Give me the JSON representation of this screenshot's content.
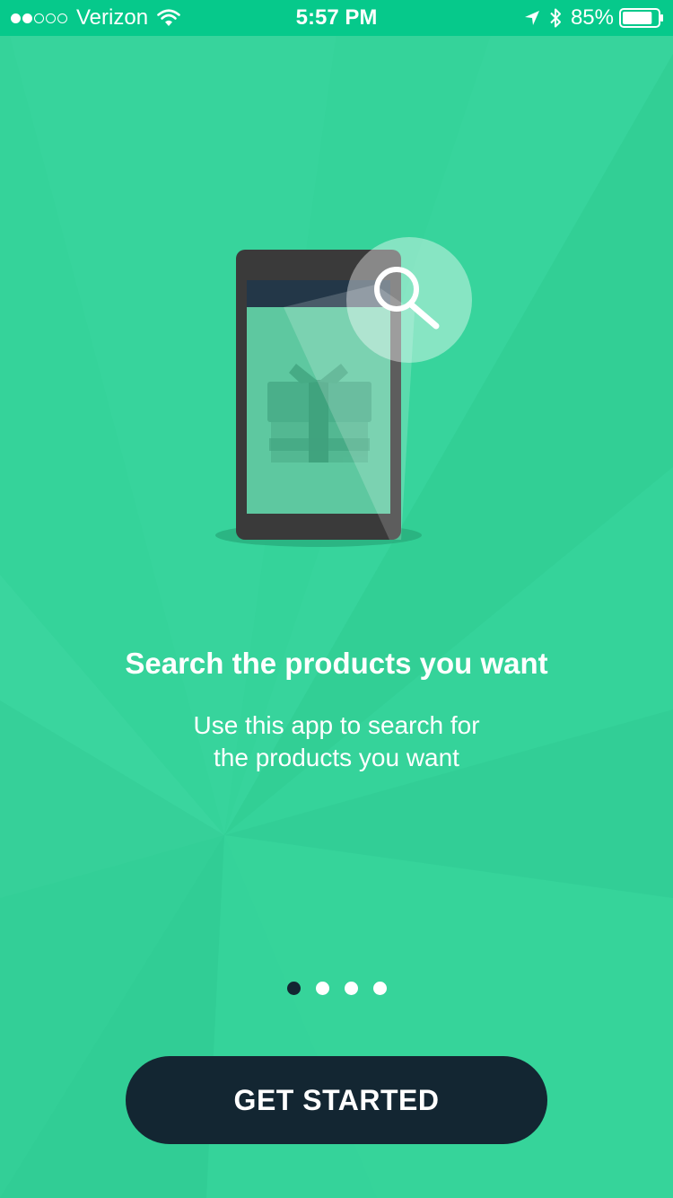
{
  "status_bar": {
    "signal_filled": 2,
    "signal_total": 5,
    "carrier": "Verizon",
    "time": "5:57 PM",
    "battery_percent": "85%",
    "battery_level": 0.85,
    "icons": [
      "wifi-icon",
      "location-arrow-icon",
      "bluetooth-icon",
      "battery-icon"
    ]
  },
  "onboarding": {
    "headline": "Search the products you want",
    "subtext_line1": "Use this app to search for",
    "subtext_line2": "the products you want",
    "illustration_icons": [
      "phone-icon",
      "gift-icon",
      "search-icon"
    ]
  },
  "pager": {
    "total_pages": 4,
    "current_page": 1
  },
  "cta": {
    "label": "GET STARTED"
  },
  "colors": {
    "background": "#35d39a",
    "status_bar": "#06c98b",
    "dark": "#132632",
    "text": "#ffffff"
  }
}
